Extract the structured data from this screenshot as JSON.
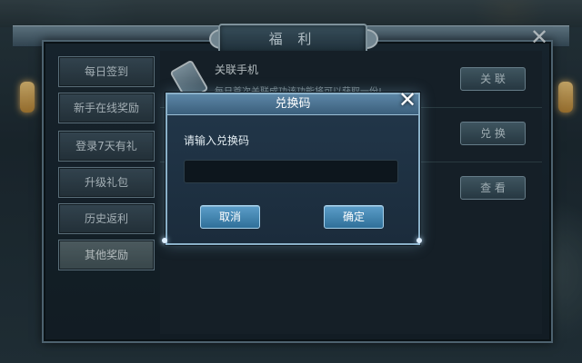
{
  "window": {
    "title": "福 利"
  },
  "sidebar": {
    "items": [
      {
        "label": "每日签到"
      },
      {
        "label": "新手在线奖励"
      },
      {
        "label": "登录7天有礼"
      },
      {
        "label": "升级礼包"
      },
      {
        "label": "历史返利"
      },
      {
        "label": "其他奖励"
      }
    ],
    "active_index": 5
  },
  "content": {
    "rows": [
      {
        "title": "关联手机",
        "description": "每日首次关联成功该功能将可以获取一份!",
        "button": "关 联"
      },
      {
        "title": "",
        "description": "",
        "button": "兑 换"
      },
      {
        "title": "",
        "description": "",
        "button": "查 看"
      }
    ]
  },
  "dialog": {
    "title": "兑换码",
    "prompt": "请输入兑换码",
    "input_value": "",
    "cancel_label": "取消",
    "confirm_label": "确定"
  },
  "icons": {
    "close": "close-icon",
    "phone": "phone-icon"
  }
}
